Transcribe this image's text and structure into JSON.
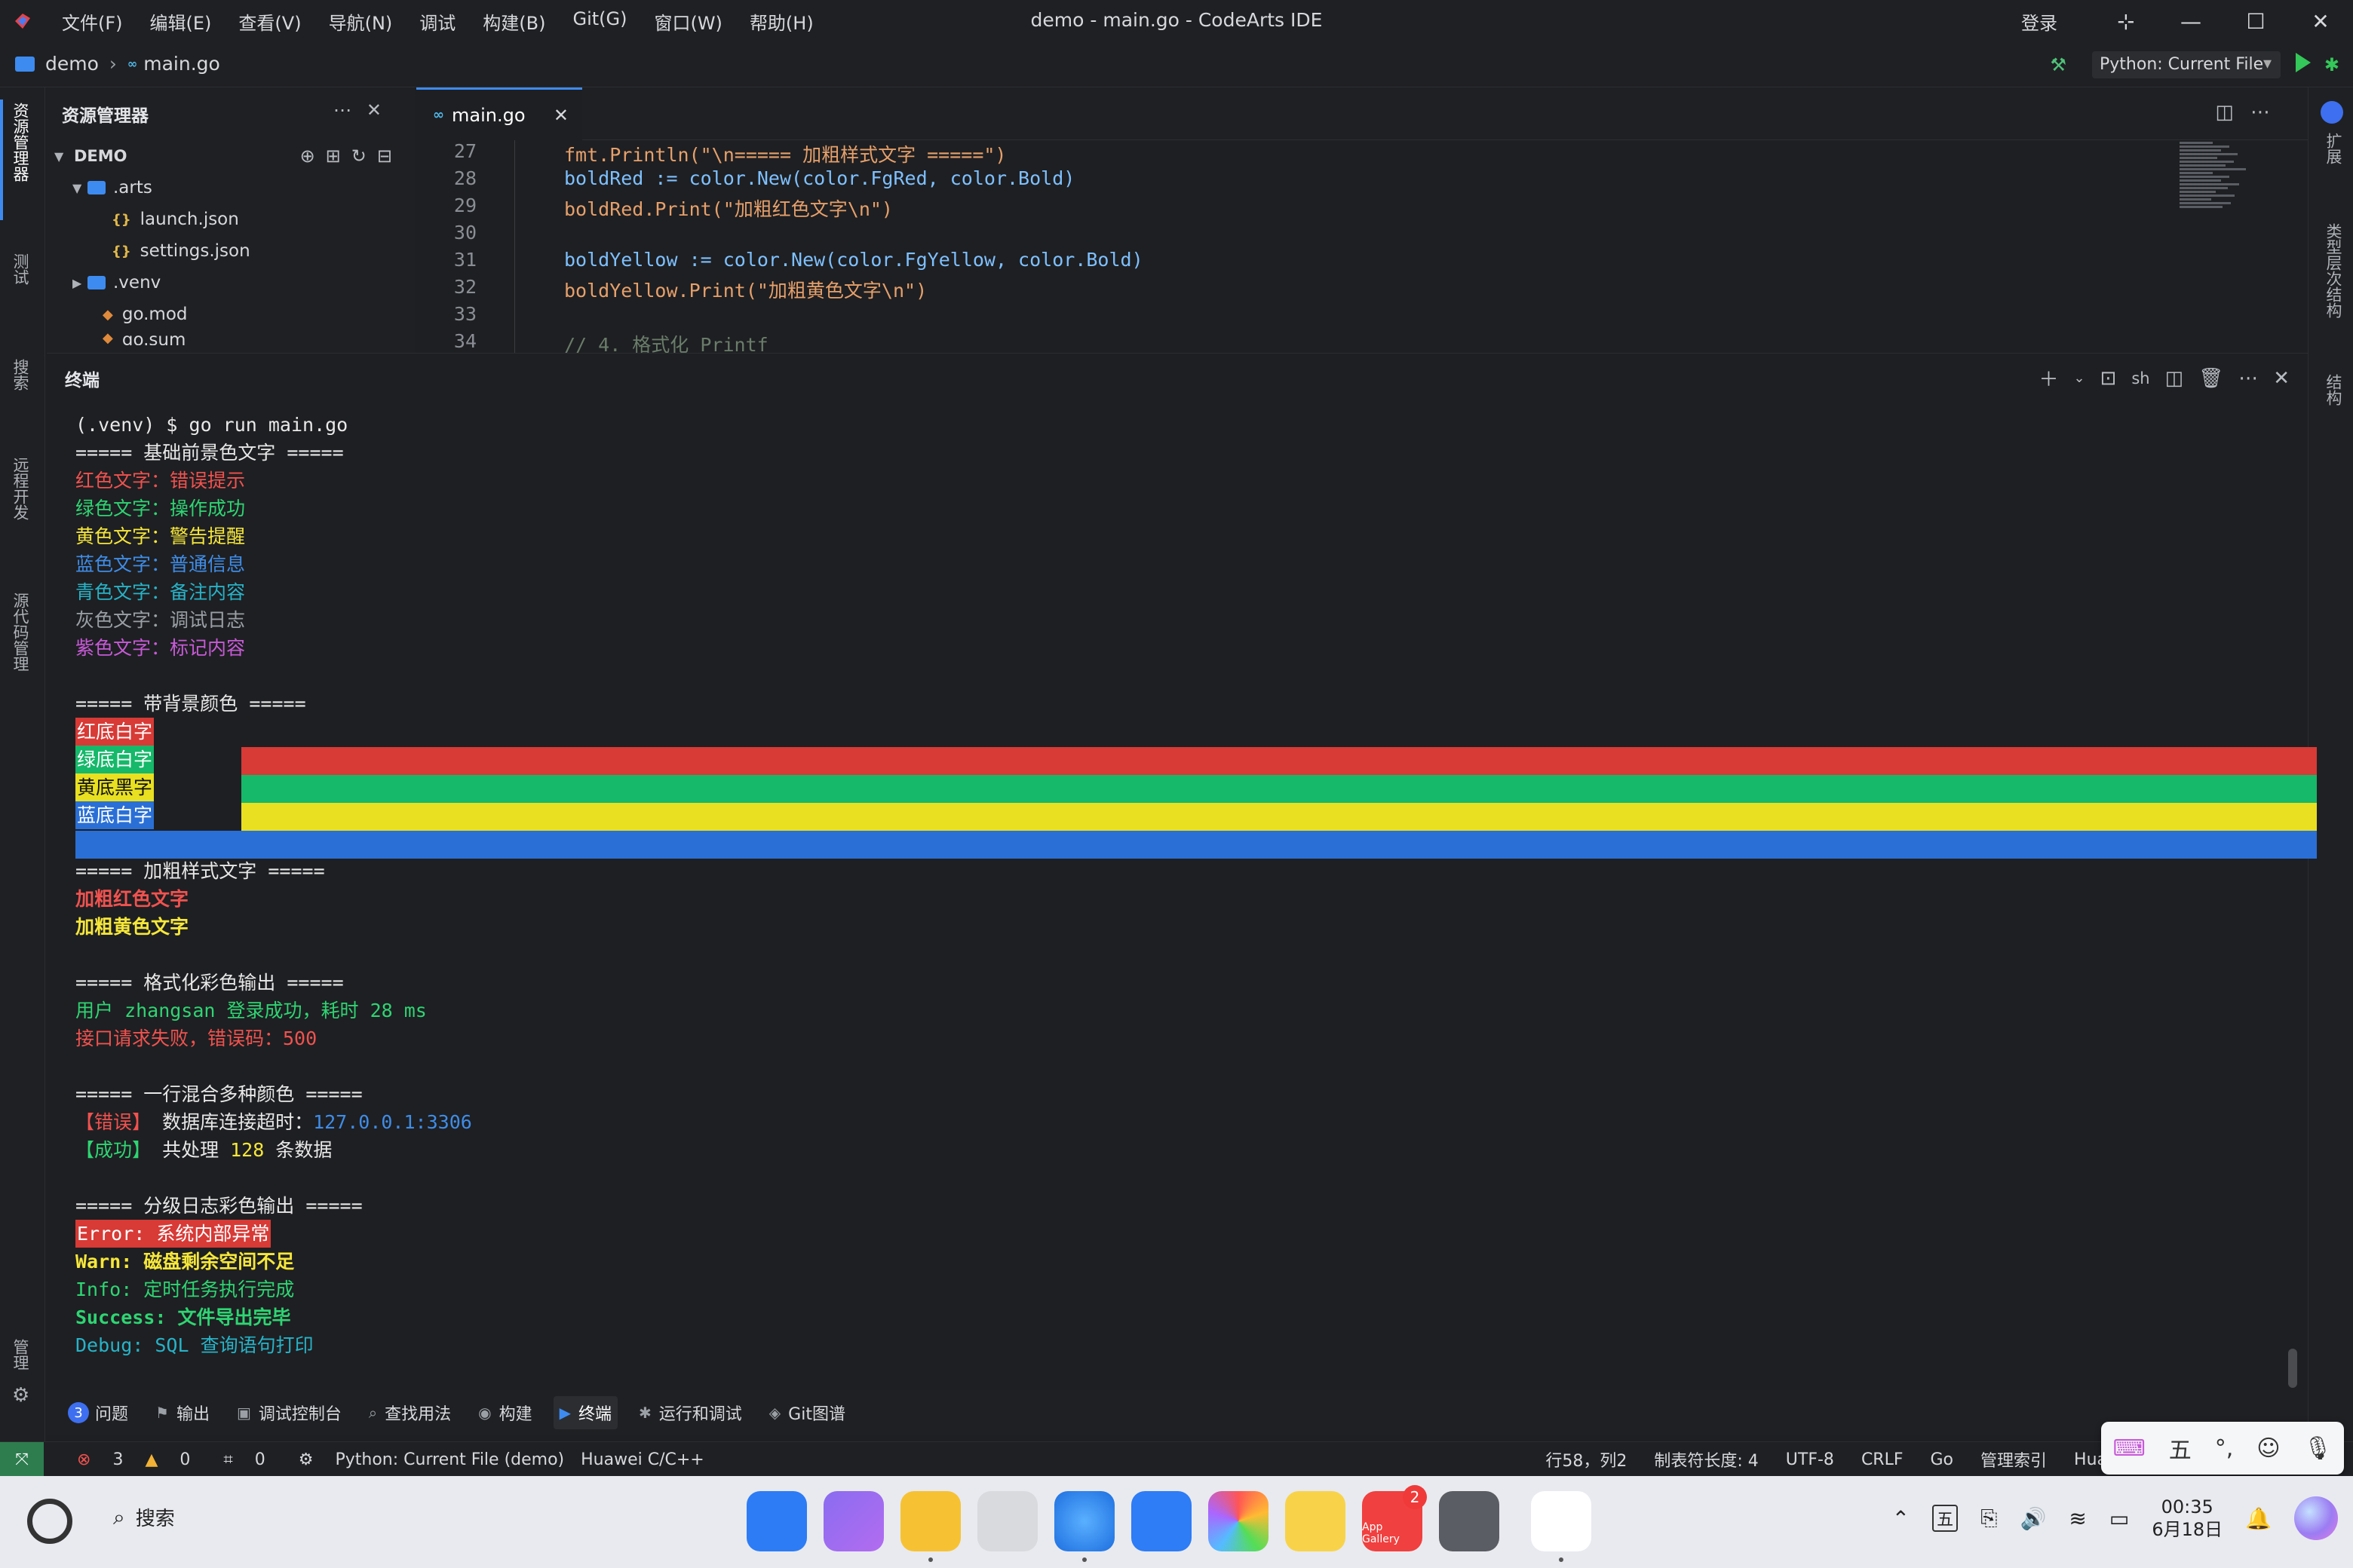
{
  "window": {
    "title": "demo - main.go - CodeArts IDE",
    "menu": [
      "文件(F)",
      "编辑(E)",
      "查看(V)",
      "导航(N)",
      "调试",
      "构建(B)",
      "Git(G)",
      "窗口(W)",
      "帮助(H)"
    ],
    "login": "登录"
  },
  "breadcrumb": {
    "project": "demo",
    "file": "main.go"
  },
  "run_config": "Python: Current File",
  "activity_bar": [
    "资源管理器",
    "测试",
    "搜索",
    "远程开发",
    "源代码管理",
    "管理"
  ],
  "right_bar": [
    "扩展",
    "类型层次结构",
    "结构"
  ],
  "explorer": {
    "title": "资源管理器",
    "root": "DEMO",
    "items": [
      {
        "name": ".arts",
        "type": "folder",
        "expanded": true
      },
      {
        "name": "launch.json",
        "type": "json"
      },
      {
        "name": "settings.json",
        "type": "json"
      },
      {
        "name": ".venv",
        "type": "folder",
        "expanded": false
      },
      {
        "name": "go.mod",
        "type": "mod"
      },
      {
        "name": "go.sum",
        "type": "mod"
      }
    ]
  },
  "editor": {
    "tab": "main.go",
    "lines": [
      {
        "no": "27",
        "text": "fmt.Println(\"\\n===== 加粗样式文字 =====\")"
      },
      {
        "no": "28",
        "text": "boldRed := color.New(color.FgRed, color.Bold)"
      },
      {
        "no": "29",
        "text": "boldRed.Print(\"加粗红色文字\\n\")"
      },
      {
        "no": "30",
        "text": ""
      },
      {
        "no": "31",
        "text": "boldYellow := color.New(color.FgYellow, color.Bold)"
      },
      {
        "no": "32",
        "text": "boldYellow.Print(\"加粗黄色文字\\n\")"
      },
      {
        "no": "33",
        "text": ""
      },
      {
        "no": "34",
        "text": "// 4. 格式化 Printf"
      }
    ]
  },
  "terminal": {
    "title": "终端",
    "shell": "sh",
    "command": "(.venv) $ go run main.go",
    "h1": "===== 基础前景色文字 =====",
    "fg": [
      {
        "text": "红色文字：错误提示",
        "color": "#f0524f"
      },
      {
        "text": "绿色文字：操作成功",
        "color": "#2ed573"
      },
      {
        "text": "黄色文字：警告提醒",
        "color": "#f6e73a"
      },
      {
        "text": "蓝色文字：普通信息",
        "color": "#3f8de8"
      },
      {
        "text": "青色文字：备注内容",
        "color": "#27b3c8"
      },
      {
        "text": "灰色文字：调试日志",
        "color": "#9aa0a6"
      },
      {
        "text": "紫色文字：标记内容",
        "color": "#c85ad8"
      }
    ],
    "h2": "===== 带背景颜色 =====",
    "bg": [
      {
        "text": "红底白字",
        "bg": "#d83a36",
        "fg": "#ffffff"
      },
      {
        "text": "绿底白字",
        "bg": "#16b86a",
        "fg": "#ffffff"
      },
      {
        "text": "黄底黑字",
        "bg": "#e8e020",
        "fg": "#111111"
      },
      {
        "text": "蓝底白字",
        "bg": "#2a6fd6",
        "fg": "#ffffff"
      }
    ],
    "h3": "===== 加粗样式文字 =====",
    "bold_red": "加粗红色文字",
    "bold_yellow": "加粗黄色文字",
    "h4": "===== 格式化彩色输出 =====",
    "fmt1": "用户 zhangsan 登录成功，耗时 28 ms",
    "fmt2": "接口请求失败，错误码：500",
    "h5": "===== 一行混合多种颜色 =====",
    "mix1_tag": "【错误】",
    "mix1_text": " 数据库连接超时：",
    "mix1_addr": "127.0.0.1:3306",
    "mix2_tag": "【成功】",
    "mix2_text": " 共处理 ",
    "mix2_num": "128",
    "mix2_end": " 条数据",
    "h6": "===== 分级日志彩色输出 =====",
    "log_error": "Error: 系统内部异常",
    "log_warn": "Warn: 磁盘剩余空间不足",
    "log_info": "Info: 定时任务执行完成",
    "log_success": "Success: 文件导出完毕",
    "log_debug": "Debug: SQL 查询语句打印"
  },
  "bottom_tabs": {
    "problems_count": "3",
    "items": [
      "问题",
      "输出",
      "调试控制台",
      "查找用法",
      "构建",
      "终端",
      "运行和调试",
      "Git图谱"
    ]
  },
  "status": {
    "errors": "3",
    "warnings": "0",
    "ports": "0",
    "run": "Python: Current File (demo)",
    "lang_server": "Huawei C/C++",
    "cursor": "行58，列2",
    "tab_size": "制表符长度: 4",
    "encoding": "UTF-8",
    "eol": "CRLF",
    "language": "Go",
    "index": "管理索引",
    "vendor": "Huawei C"
  },
  "ime": {
    "mode": "五",
    "punct": "°,"
  },
  "taskbar": {
    "search": "搜索",
    "appgallery_badge": "2",
    "appgallery_label": "App Gallery",
    "ime": "五",
    "time": "00:35",
    "date": "6月18日"
  }
}
